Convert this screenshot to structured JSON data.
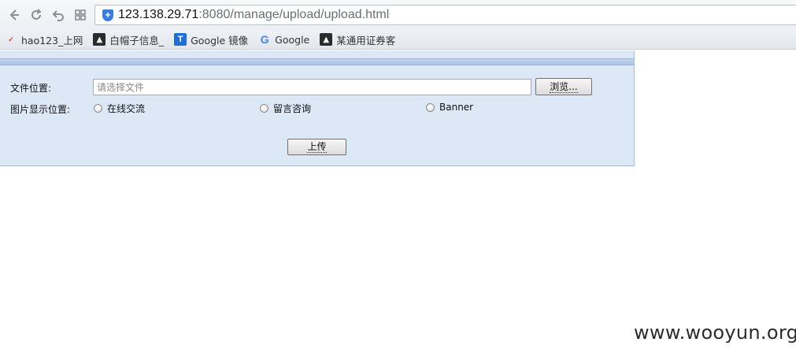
{
  "browser": {
    "url_host": "123.138.29.71",
    "url_rest": ":8080/manage/upload/upload.html",
    "bookmarks": [
      {
        "label": "hao123_上网",
        "icon": "hao123-icon"
      },
      {
        "label": "白帽子信息_",
        "icon": "hat-icon"
      },
      {
        "label": "Google 镜像",
        "icon": "t-icon"
      },
      {
        "label": "Google",
        "icon": "google-icon"
      },
      {
        "label": "某通用证券客",
        "icon": "hat-icon"
      }
    ]
  },
  "form": {
    "file_label": "文件位置:",
    "file_placeholder": "请选择文件",
    "browse_label": "浏览...",
    "position_label": "图片显示位置:",
    "options": [
      "在线交流",
      "留言咨询",
      "Banner"
    ],
    "upload_label": "上传"
  },
  "watermark": "www.wooyun.org",
  "colors": {
    "panel_bg": "#dde8f6",
    "panel_header": "#aac3e6"
  }
}
